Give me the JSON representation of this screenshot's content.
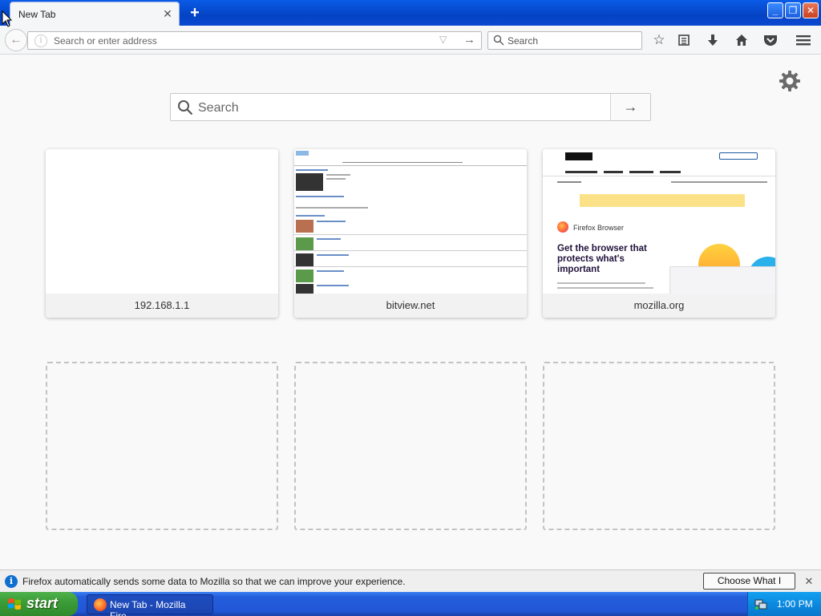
{
  "browser": {
    "tab_title": "New Tab",
    "urlbar_placeholder": "Search or enter address",
    "searchbar_placeholder": "Search"
  },
  "newtab": {
    "search_placeholder": "Search",
    "tiles": [
      {
        "label": "192.168.1.1"
      },
      {
        "label": "bitview.net"
      },
      {
        "label": "mozilla.org"
      }
    ],
    "mozilla_thumb": {
      "logo_text": "moz://a",
      "product": "Firefox Browser",
      "headline": "Get the browser that protects what's important"
    }
  },
  "notification": {
    "message": "Firefox automatically sends some data to Mozilla so that we can improve your experience.",
    "button_label": "Choose What I Share"
  },
  "taskbar": {
    "start_label": "start",
    "task_label": "New Tab - Mozilla Fire...",
    "clock": "1:00 PM"
  },
  "colors": {
    "titlebar": "#0a52de",
    "taskbar": "#245edb",
    "start_green": "#3c9d38",
    "notif_info": "#1170cf"
  }
}
